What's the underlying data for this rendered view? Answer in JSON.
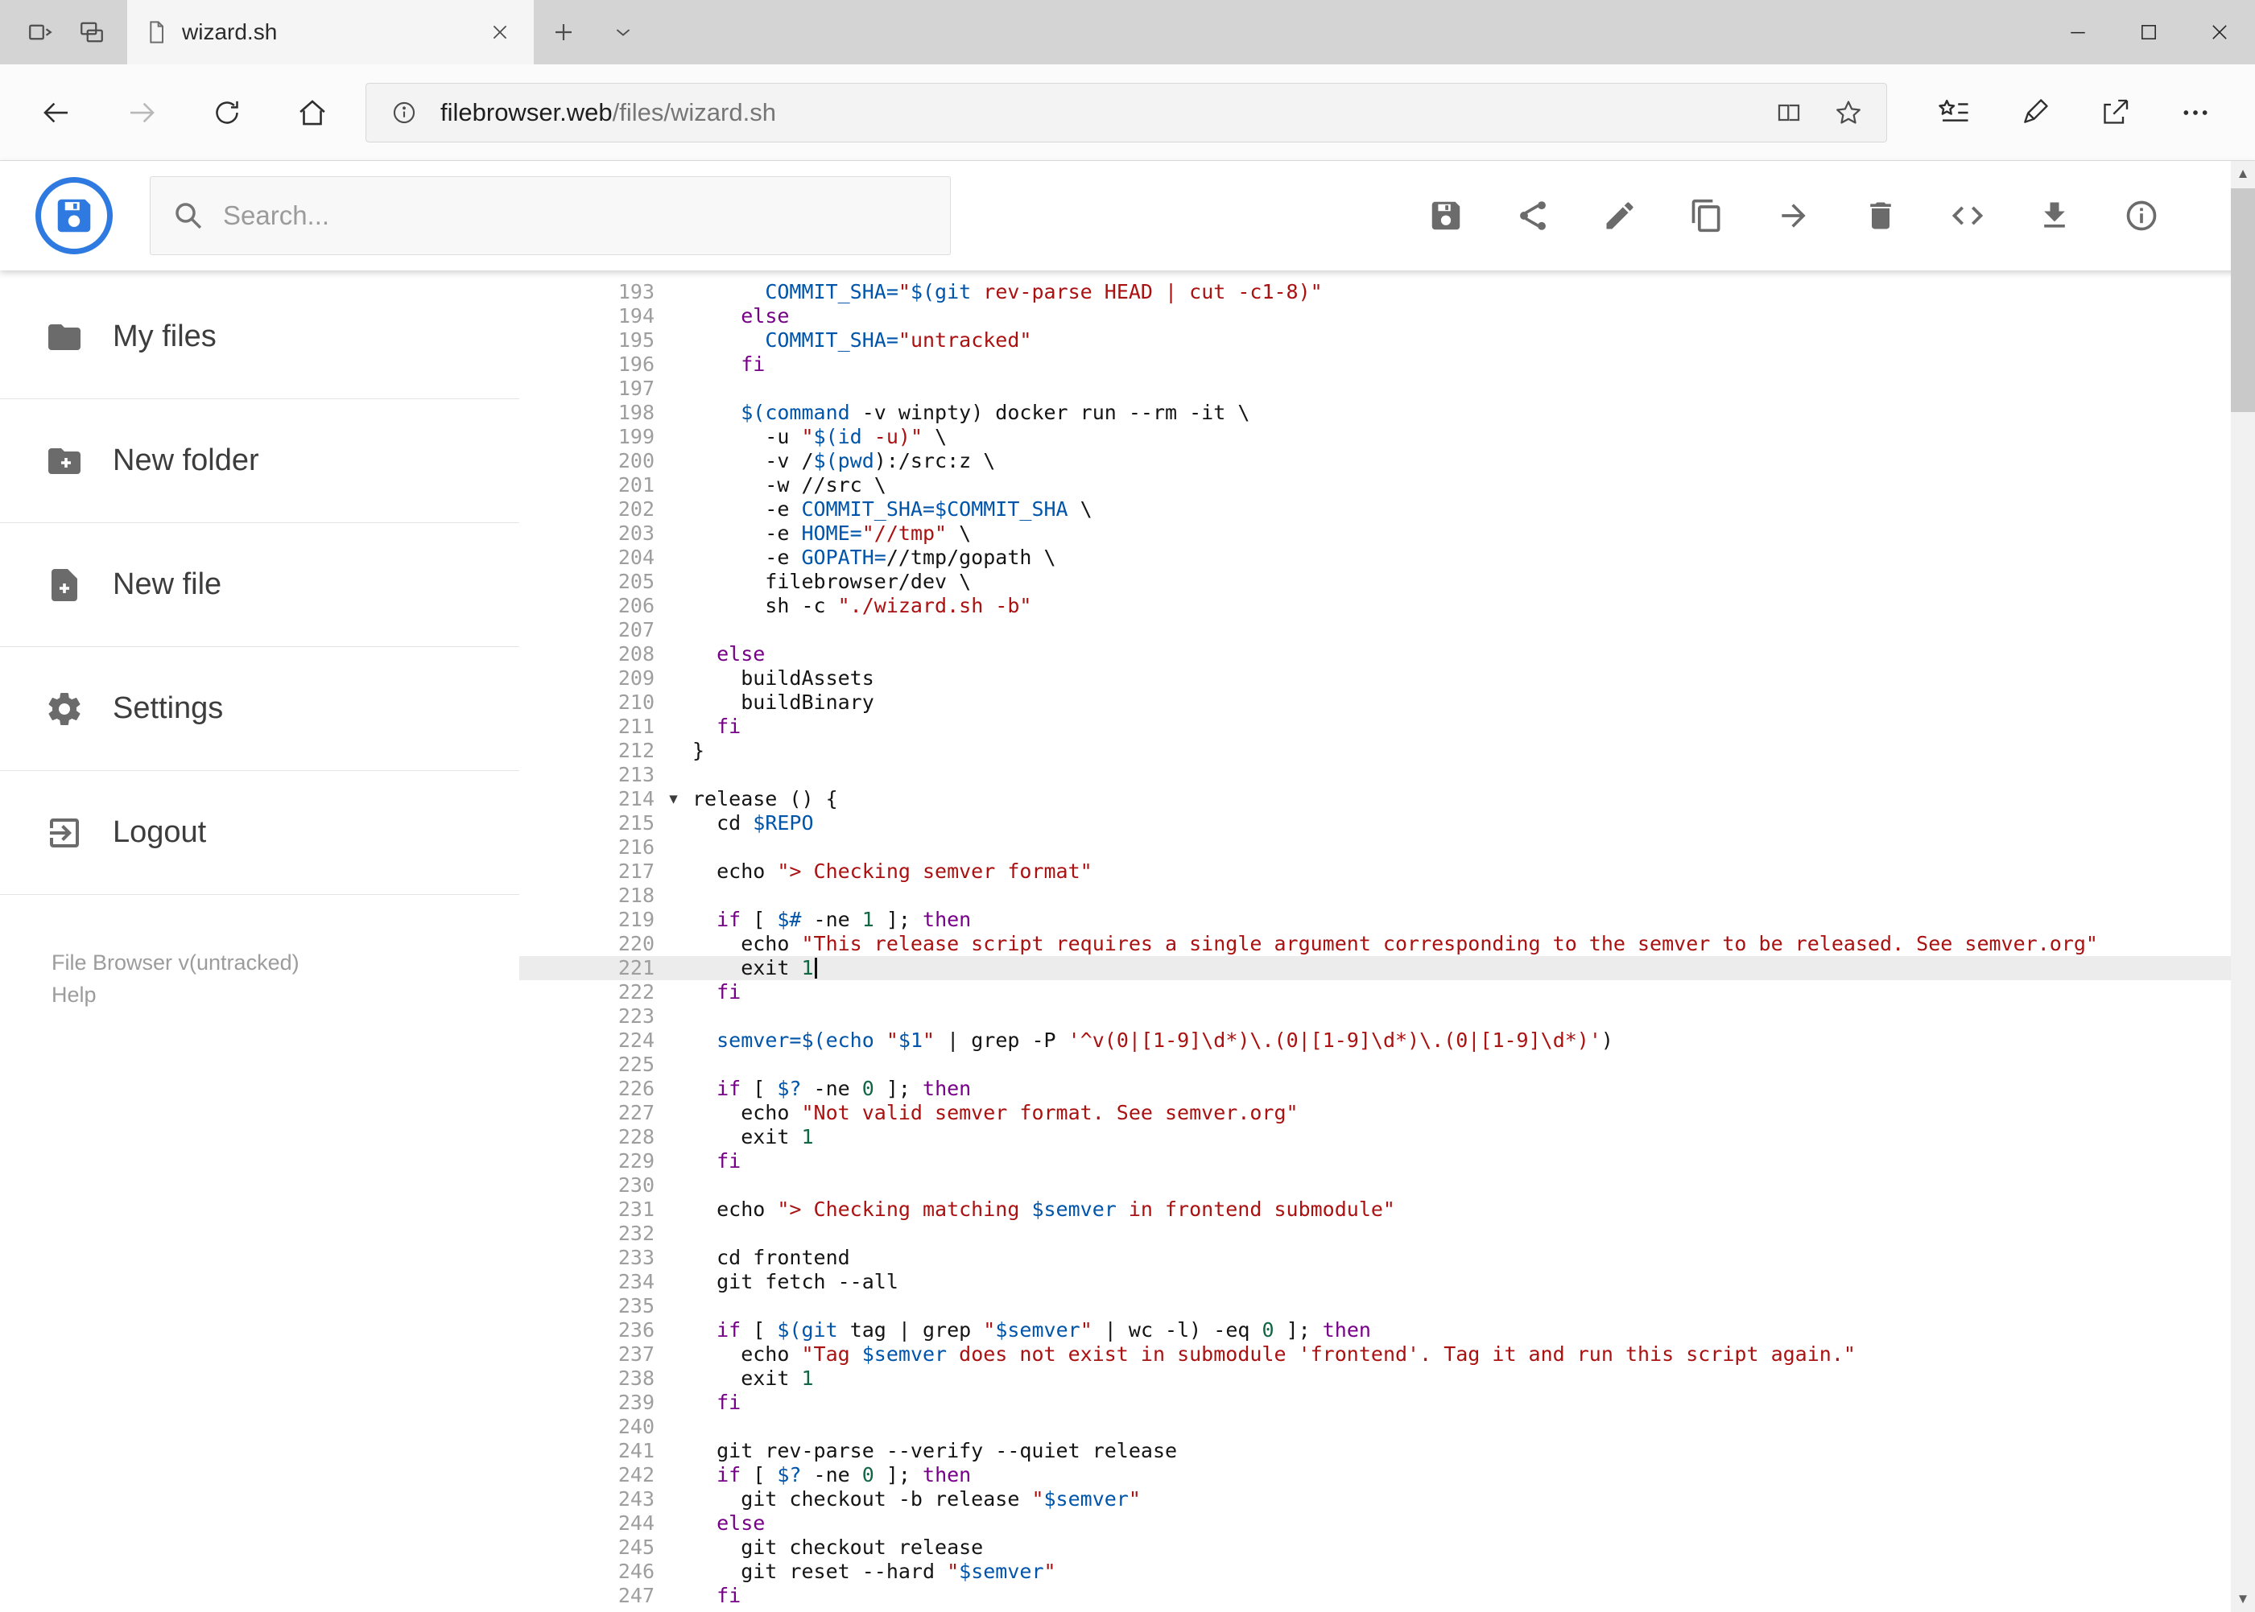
{
  "window": {
    "tab_title": "wizard.sh"
  },
  "address_bar": {
    "url_host": "filebrowser.web",
    "url_path": "/files/wizard.sh"
  },
  "header": {
    "search_placeholder": "Search..."
  },
  "sidebar": {
    "items": [
      {
        "label": "My files"
      },
      {
        "label": "New folder"
      },
      {
        "label": "New file"
      },
      {
        "label": "Settings"
      },
      {
        "label": "Logout"
      }
    ],
    "footer_version": "File Browser v(untracked)",
    "footer_help": "Help"
  },
  "scrollbar": {
    "up_glyph": "▲",
    "down_glyph": "▼"
  },
  "colors": {
    "accent_blue": "#2f7ae0"
  },
  "editor": {
    "first_line": 193,
    "active_line": 221,
    "folded_lines": [
      214
    ],
    "fold_marker_glyph": "▾",
    "cursor": {
      "line": 221,
      "column": 10
    },
    "syntax_colors": {
      "keyword": "#770088",
      "string": "#aa1111",
      "variable": "#0055aa",
      "number": "#116644",
      "plain": "#141414"
    },
    "lines": [
      "      COMMIT_SHA=\"$(git rev-parse HEAD | cut -c1-8)\"",
      "    else",
      "      COMMIT_SHA=\"untracked\"",
      "    fi",
      "",
      "    $(command -v winpty) docker run --rm -it \\",
      "      -u \"$(id -u)\" \\",
      "      -v /$(pwd):/src:z \\",
      "      -w //src \\",
      "      -e COMMIT_SHA=$COMMIT_SHA \\",
      "      -e HOME=\"//tmp\" \\",
      "      -e GOPATH=//tmp/gopath \\",
      "      filebrowser/dev \\",
      "      sh -c \"./wizard.sh -b\"",
      "",
      "  else",
      "    buildAssets",
      "    buildBinary",
      "  fi",
      "}",
      "",
      "release () {",
      "  cd $REPO",
      "",
      "  echo \"> Checking semver format\"",
      "",
      "  if [ $# -ne 1 ]; then",
      "    echo \"This release script requires a single argument corresponding to the semver to be released. See semver.org\"",
      "    exit 1",
      "  fi",
      "",
      "  semver=$(echo \"$1\" | grep -P '^v(0|[1-9]\\d*)\\.(0|[1-9]\\d*)\\.(0|[1-9]\\d*)')",
      "",
      "  if [ $? -ne 0 ]; then",
      "    echo \"Not valid semver format. See semver.org\"",
      "    exit 1",
      "  fi",
      "",
      "  echo \"> Checking matching $semver in frontend submodule\"",
      "",
      "  cd frontend",
      "  git fetch --all",
      "",
      "  if [ $(git tag | grep \"$semver\" | wc -l) -eq 0 ]; then",
      "    echo \"Tag $semver does not exist in submodule 'frontend'. Tag it and run this script again.\"",
      "    exit 1",
      "  fi",
      "",
      "  git rev-parse --verify --quiet release",
      "  if [ $? -ne 0 ]; then",
      "    git checkout -b release \"$semver\"",
      "  else",
      "    git checkout release",
      "    git reset --hard \"$semver\"",
      "  fi"
    ]
  }
}
